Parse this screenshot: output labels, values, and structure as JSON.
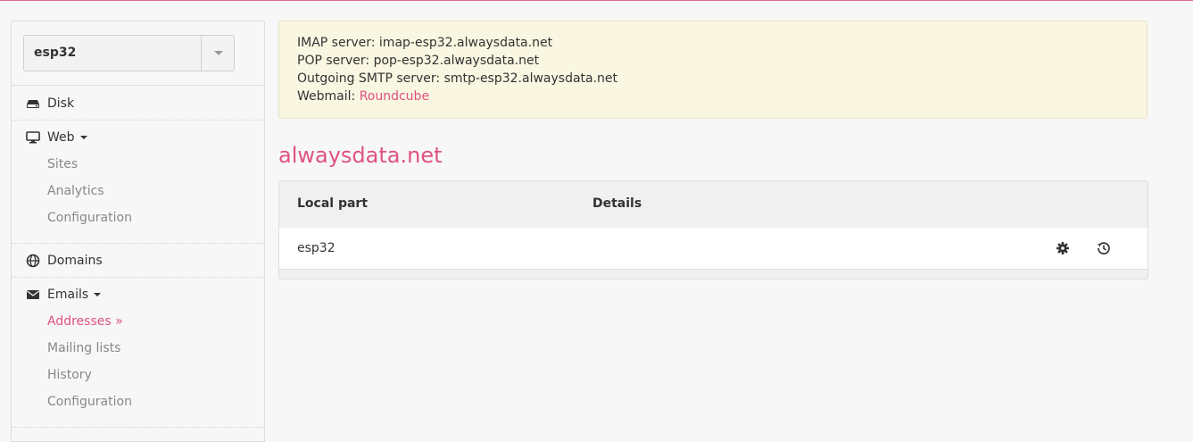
{
  "account": {
    "selected": "esp32"
  },
  "sidebar": {
    "disk": {
      "label": "Disk",
      "icon": "disk-icon"
    },
    "web": {
      "label": "Web",
      "icon": "monitor-icon",
      "items": [
        {
          "label": "Sites"
        },
        {
          "label": "Analytics"
        },
        {
          "label": "Configuration"
        }
      ]
    },
    "domains": {
      "label": "Domains",
      "icon": "globe-icon"
    },
    "emails": {
      "label": "Emails",
      "icon": "envelope-icon",
      "items": [
        {
          "label": "Addresses »",
          "active": true
        },
        {
          "label": "Mailing lists"
        },
        {
          "label": "History"
        },
        {
          "label": "Configuration"
        }
      ]
    }
  },
  "info": {
    "imap": "IMAP server: imap-esp32.alwaysdata.net",
    "pop": "POP server: pop-esp32.alwaysdata.net",
    "smtp": "Outgoing SMTP server: smtp-esp32.alwaysdata.net",
    "webmail_prefix": "Webmail: ",
    "webmail_link": "Roundcube"
  },
  "domain_title": "alwaysdata.net",
  "table": {
    "headers": [
      "Local part",
      "Details"
    ],
    "rows": [
      {
        "local_part": "esp32",
        "details": ""
      }
    ]
  },
  "colors": {
    "accent": "#e0527f",
    "info_bg": "#f9f6e1"
  }
}
